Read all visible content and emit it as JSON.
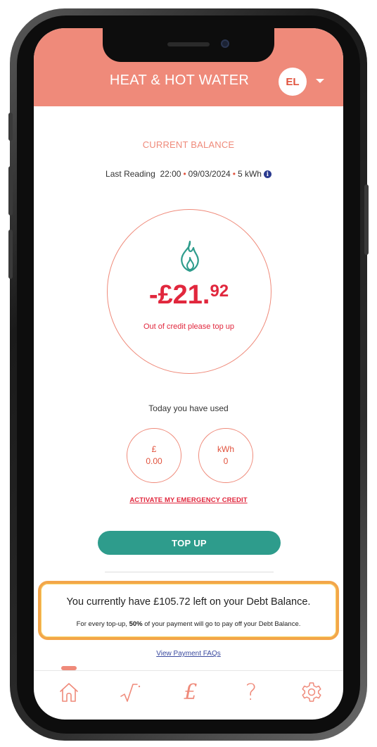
{
  "header": {
    "title": "HEAT & HOT WATER",
    "avatar_initials": "EL"
  },
  "balance": {
    "label": "CURRENT BALANCE",
    "last_reading_label": "Last Reading",
    "reading_time": "22:00",
    "reading_date": "09/03/2024",
    "reading_energy": "5 kWh",
    "amount_main": "-£21.",
    "amount_pence": "92",
    "status_message": "Out of credit please top up"
  },
  "usage": {
    "label": "Today you have used",
    "cost_unit": "£",
    "cost_value": "0.00",
    "energy_unit": "kWh",
    "energy_value": "0"
  },
  "actions": {
    "emergency_credit": "ACTIVATE MY EMERGENCY CREDIT",
    "top_up": "TOP UP"
  },
  "debt": {
    "main_text": "You currently have £105.72 left on your Debt Balance.",
    "sub_prefix": "For every top-up, ",
    "sub_percent": "50%",
    "sub_suffix": " of your payment will go to pay off your Debt Balance."
  },
  "faq_link": "View Payment FAQs",
  "tabs": [
    {
      "icon": "home-icon"
    },
    {
      "icon": "usage-graph-icon"
    },
    {
      "icon": "pound-icon",
      "glyph": "£"
    },
    {
      "icon": "help-icon",
      "glyph": "?"
    },
    {
      "icon": "settings-icon"
    }
  ],
  "colors": {
    "accent": "#ef8a7a",
    "alert": "#e1273d",
    "teal": "#2e9c8c",
    "highlight_border": "#f3a64a"
  }
}
